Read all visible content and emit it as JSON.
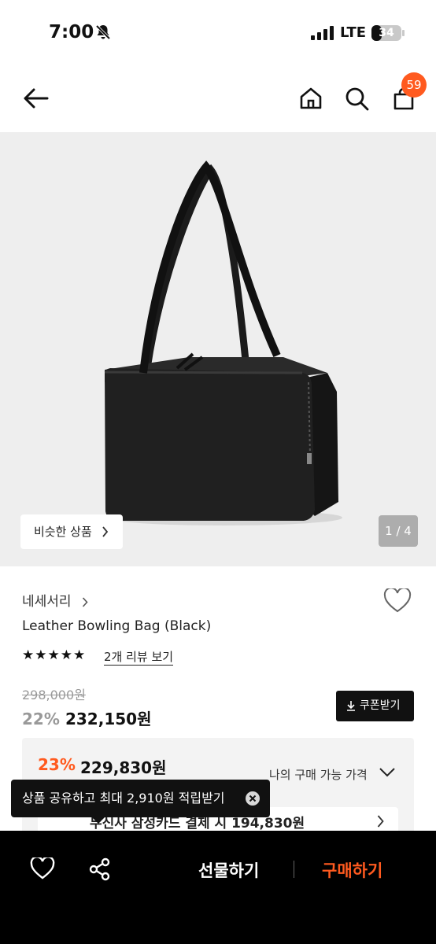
{
  "status_bar": {
    "time": "7:00",
    "network": "LTE",
    "battery": "34",
    "battery_level": 0.34,
    "icons": [
      "bell-muted-icon",
      "signal-icon",
      "battery-icon"
    ]
  },
  "nav": {
    "back_icon": "arrow-left-icon",
    "home_icon": "home-icon",
    "search_icon": "search-icon",
    "cart_icon": "shopping-bag-icon",
    "cart_count": "59"
  },
  "gallery": {
    "similar_label": "비슷한 상품",
    "page_indicator": "1 / 4"
  },
  "product": {
    "brand": "네세서리",
    "name": "Leather Bowling Bag (Black)",
    "stars": "★★★★★",
    "rating": 5,
    "review_link": "2개 리뷰 보기",
    "original_price": "298,000원",
    "discount_rate": "22%",
    "sale_price": "232,150원",
    "coupon_label": "쿠폰받기"
  },
  "best_price": {
    "discount_rate": "23%",
    "price": "229,830원",
    "my_price_label": "나의 구매 가능 가격",
    "card_text": "무신사 삼성카드 결제 시 194,830원"
  },
  "toast": {
    "message": "상품 공유하고 최대 2,910원 적립받기"
  },
  "bottom_bar": {
    "gift_label": "선물하기",
    "buy_label": "구매하기"
  },
  "colors": {
    "accent": "#ff5a1f",
    "dark": "#111111",
    "image_bg": "#eeeeee"
  }
}
